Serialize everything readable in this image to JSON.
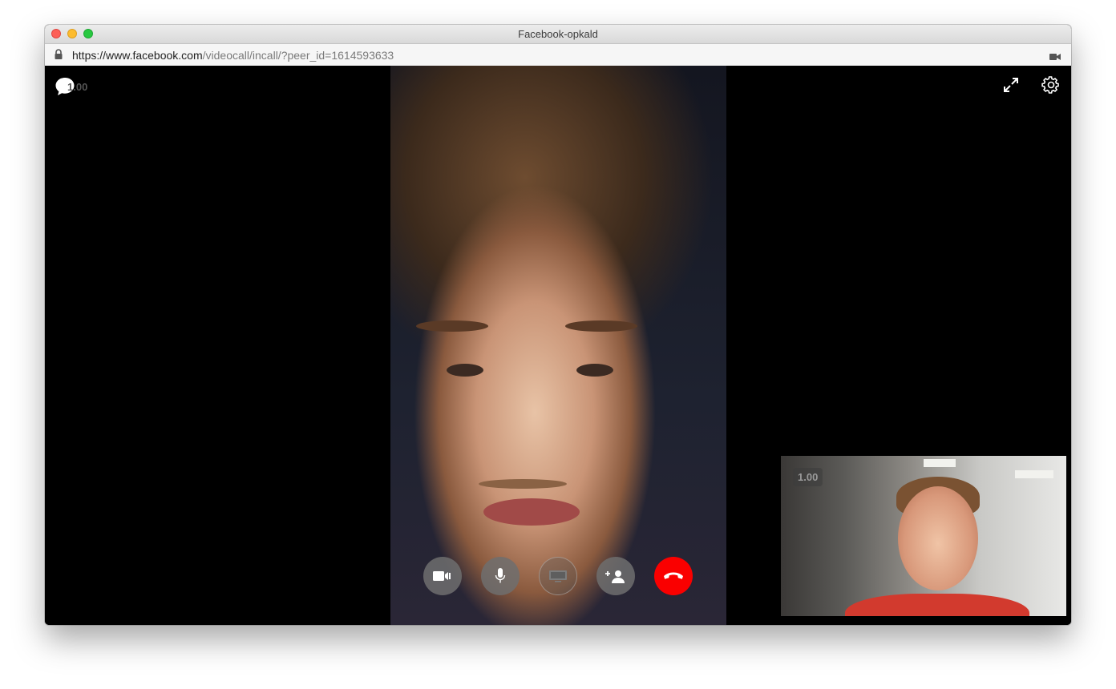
{
  "window": {
    "title": "Facebook-opkald",
    "url_host": "https://www.facebook.com",
    "url_path": "/videocall/incall/?peer_id=1614593633"
  },
  "icons": {
    "lock": "lock-icon",
    "camera_indicator": "video-camera-icon",
    "chat": "chat-bubble-icon",
    "fullscreen": "expand-arrows-icon",
    "settings": "gear-icon",
    "video": "video-camera-icon",
    "mic": "microphone-icon",
    "screen_share": "screen-share-icon",
    "add_person": "add-person-icon",
    "end_call": "phone-hangup-icon"
  },
  "call": {
    "remote_quality": "1.00",
    "self_quality": "1.00"
  },
  "colors": {
    "end_call": "#fa0000",
    "control_grey": "#6e6e6e",
    "stage": "#000000"
  }
}
